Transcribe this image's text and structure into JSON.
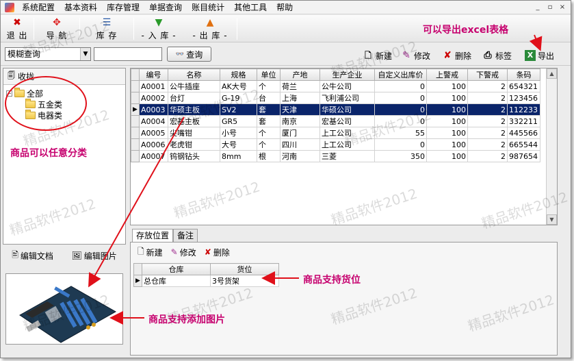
{
  "menu": [
    "系统配置",
    "基本资料",
    "库存管理",
    "单据查询",
    "账目统计",
    "其他工具",
    "帮助"
  ],
  "window_controls": [
    "_",
    "▫",
    "×"
  ],
  "toolbar": {
    "exit": "退 出",
    "nav": "导 航",
    "stock": "库 存",
    "in": "- 入 库 -",
    "out": "- 出 库 -"
  },
  "search": {
    "mode": "模糊查询",
    "input_value": "",
    "query_label": "查询"
  },
  "actions": {
    "new": "新建",
    "edit": "修改",
    "delete": "删除",
    "label": "标签",
    "export": "导出"
  },
  "left": {
    "title": "收拢",
    "tree_root": "全部",
    "tree_children": [
      "五金类",
      "电器类"
    ],
    "edit_doc": "编辑文档",
    "edit_image": "编辑图片"
  },
  "grid": {
    "columns": [
      "编号",
      "名称",
      "规格",
      "单位",
      "产地",
      "生产企业",
      "自定义出库价",
      "上警戒",
      "下警戒",
      "条码"
    ],
    "rows": [
      [
        "A0001",
        "公牛插座",
        "AK大号",
        "个",
        "荷兰",
        "公牛公司",
        "0",
        "100",
        "2",
        "654321"
      ],
      [
        "A0002",
        "台灯",
        "G-19",
        "台",
        "上海",
        "飞利浦公司",
        "0",
        "100",
        "2",
        "123456"
      ],
      [
        "A0003",
        "华硕主板",
        "SV2",
        "套",
        "天津",
        "华硕公司",
        "0",
        "100",
        "2",
        "112233"
      ],
      [
        "A0004",
        "宏基主板",
        "GR5",
        "套",
        "南京",
        "宏基公司",
        "0",
        "100",
        "2",
        "332211"
      ],
      [
        "A0005",
        "尖嘴钳",
        "小号",
        "个",
        "厦门",
        "上工公司",
        "55",
        "100",
        "2",
        "445566"
      ],
      [
        "A0006",
        "老虎钳",
        "大号",
        "个",
        "四川",
        "上工公司",
        "0",
        "100",
        "2",
        "665544"
      ],
      [
        "A0007",
        "钨钢钻头",
        "8mm",
        "根",
        "河南",
        "三菱",
        "350",
        "100",
        "2",
        "987654"
      ]
    ],
    "selected_row": 2
  },
  "tabs": [
    "存放位置",
    "备注"
  ],
  "bottom": {
    "new": "新建",
    "edit": "修改",
    "delete": "删除",
    "columns": [
      "仓库",
      "货位"
    ],
    "rows": [
      [
        "总仓库",
        "3号货架"
      ]
    ]
  },
  "annotations": {
    "export_note": "可以导出excel表格",
    "category_note": "商品可以任意分类",
    "location_note": "商品支持货位",
    "image_note": "商品支持添加图片",
    "accent_color": "#c6006e",
    "arrow_color": "#e0101a"
  },
  "watermark": "精品软件2012"
}
